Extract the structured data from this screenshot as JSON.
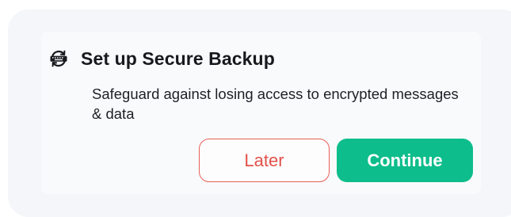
{
  "toast": {
    "icon": "secure-backup-icon",
    "title": "Set up Secure Backup",
    "description": "Safeguard against losing access to encrypted messages & data",
    "buttons": {
      "later_label": "Later",
      "continue_label": "Continue"
    }
  },
  "colors": {
    "accent": "#0dbd8b",
    "danger": "#e3514a",
    "panel": "#f4f6fa",
    "text": "#17191c"
  }
}
